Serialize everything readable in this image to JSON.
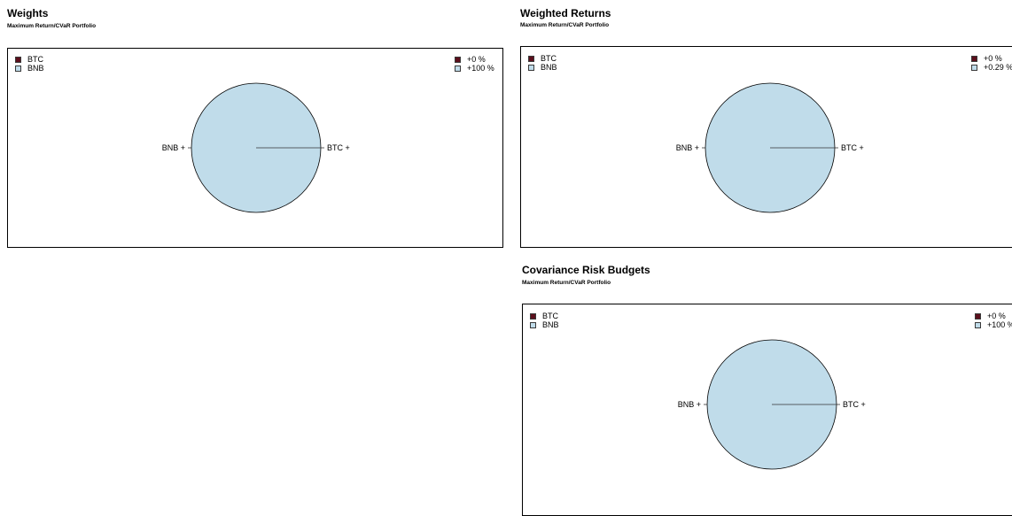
{
  "colors": {
    "btc": "#5b0f1c",
    "bnb": "#c0dcea",
    "border": "#000000"
  },
  "chart_data": [
    {
      "type": "pie",
      "title": "Weights",
      "subtitle": "Maximum Return/CVaR Portfolio",
      "legend_left": [
        "BTC",
        "BNB"
      ],
      "legend_right": [
        "+0 %",
        "+100 %"
      ],
      "slices": [
        {
          "label": "BTC",
          "value": 0,
          "point_label": "BTC +"
        },
        {
          "label": "BNB",
          "value": 100,
          "point_label": "BNB +"
        }
      ]
    },
    {
      "type": "pie",
      "title": "Weighted Returns",
      "subtitle": "Maximum Return/CVaR Portfolio",
      "legend_left": [
        "BTC",
        "BNB"
      ],
      "legend_right": [
        "+0 %",
        "+0.29 %"
      ],
      "slices": [
        {
          "label": "BTC",
          "value": 0,
          "point_label": "BTC +"
        },
        {
          "label": "BNB",
          "value": 0.29,
          "point_label": "BNB +"
        }
      ]
    },
    {
      "type": "pie",
      "title": "Covariance Risk Budgets",
      "subtitle": "Maximum Return/CVaR Portfolio",
      "legend_left": [
        "BTC",
        "BNB"
      ],
      "legend_right": [
        "+0 %",
        "+100 %"
      ],
      "slices": [
        {
          "label": "BTC",
          "value": 0,
          "point_label": "BTC +"
        },
        {
          "label": "BNB",
          "value": 100,
          "point_label": "BNB +"
        }
      ]
    }
  ]
}
